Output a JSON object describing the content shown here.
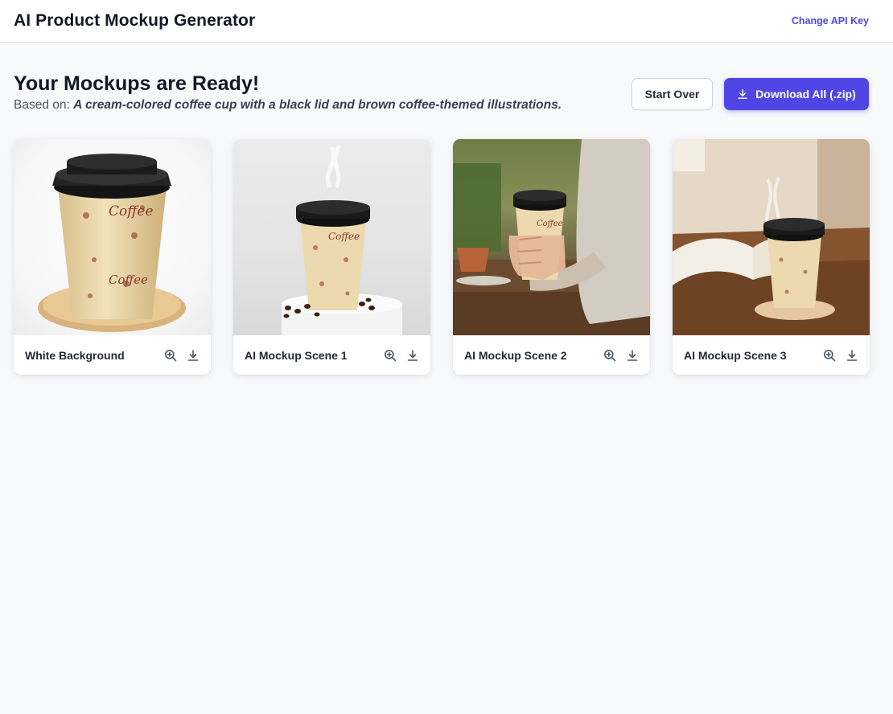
{
  "app": {
    "title": "AI Product Mockup Generator",
    "change_api_key": "Change API Key"
  },
  "results": {
    "heading": "Your Mockups are Ready!",
    "based_on_prefix": "Based on:",
    "description": "A cream-colored coffee cup with a black lid and brown coffee-themed illustrations."
  },
  "actions": {
    "start_over": "Start Over",
    "download_all": "Download All (.zip)"
  },
  "mockups": [
    {
      "label": "White Background",
      "zoom_icon": "zoom-in-icon",
      "download_icon": "download-icon"
    },
    {
      "label": "AI Mockup Scene 1",
      "zoom_icon": "zoom-in-icon",
      "download_icon": "download-icon"
    },
    {
      "label": "AI Mockup Scene 2",
      "zoom_icon": "zoom-in-icon",
      "download_icon": "download-icon"
    },
    {
      "label": "AI Mockup Scene 3",
      "zoom_icon": "zoom-in-icon",
      "download_icon": "download-icon"
    }
  ],
  "colors": {
    "accent": "#4f46e5",
    "page_bg": "#f8f9fb",
    "cup_cream": "#ecd9ad",
    "cup_lid": "#1e1e1e"
  }
}
